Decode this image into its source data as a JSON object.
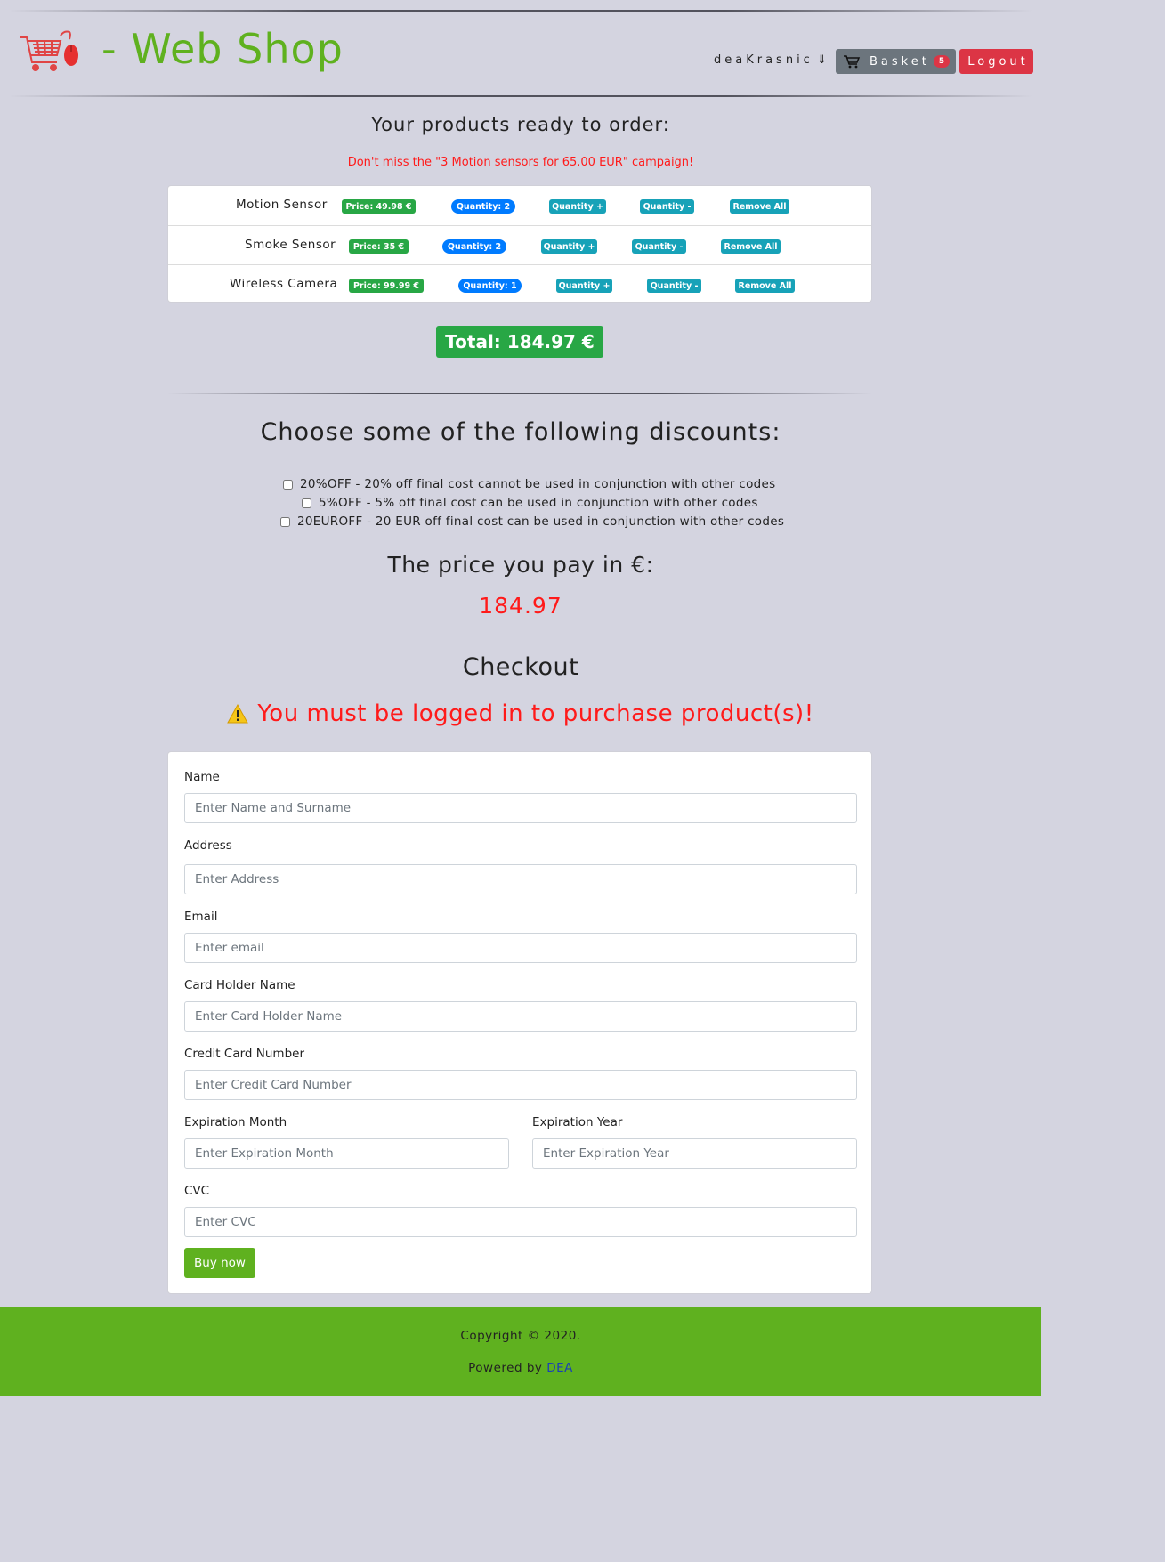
{
  "header": {
    "site_title": "- Web Shop",
    "username": "deaKrasnic",
    "basket_label": "Basket",
    "basket_count": "5",
    "logout_label": "Logout"
  },
  "basket": {
    "heading": "Your products ready to order:",
    "campaign": "Don't miss the \"3 Motion sensors for 65.00 EUR\" campaign!",
    "products": [
      {
        "name": "Motion Sensor",
        "price": "Price: 49.98 €",
        "quantity": "Quantity: 2",
        "inc": "Quantity +",
        "dec": "Quantity -",
        "remove": "Remove All"
      },
      {
        "name": "Smoke Sensor",
        "price": "Price: 35 €",
        "quantity": "Quantity: 2",
        "inc": "Quantity +",
        "dec": "Quantity -",
        "remove": "Remove All"
      },
      {
        "name": "Wireless Camera",
        "price": "Price: 99.99 €",
        "quantity": "Quantity: 1",
        "inc": "Quantity +",
        "dec": "Quantity -",
        "remove": "Remove All"
      }
    ],
    "total": "Total: 184.97 €"
  },
  "discounts": {
    "heading": "Choose some of the following discounts:",
    "options": [
      "20%OFF - 20% off final cost cannot be used in conjunction with other codes",
      "5%OFF - 5% off final cost can be used in conjunction with other codes",
      "20EUROFF - 20 EUR off final cost can be used in conjunction with other codes"
    ]
  },
  "price": {
    "heading": "The price you pay in €:",
    "value": "184.97"
  },
  "checkout": {
    "heading": "Checkout",
    "warning": "You must be logged in to purchase product(s)!",
    "fields": {
      "name": {
        "label": "Name",
        "placeholder": "Enter Name and Surname"
      },
      "address": {
        "label": "Address",
        "placeholder": "Enter Address"
      },
      "email": {
        "label": "Email",
        "placeholder": "Enter email"
      },
      "card_holder": {
        "label": "Card Holder Name",
        "placeholder": "Enter Card Holder Name"
      },
      "card_number": {
        "label": "Credit Card Number",
        "placeholder": "Enter Credit Card Number"
      },
      "exp_month": {
        "label": "Expiration Month",
        "placeholder": "Enter Expiration Month"
      },
      "exp_year": {
        "label": "Expiration Year",
        "placeholder": "Enter Expiration Year"
      },
      "cvc": {
        "label": "CVC",
        "placeholder": "Enter CVC"
      }
    },
    "buy_label": "Buy now"
  },
  "footer": {
    "copyright": "Copyright © 2020.",
    "powered_prefix": "Powered by",
    "powered_link": "DEA"
  },
  "colors": {
    "brand_green": "#5fb11f",
    "badge_green": "#28a745",
    "badge_blue": "#007bff",
    "badge_teal": "#17a2b8",
    "danger_red": "#dc3545",
    "alert_text_red": "#ff1a1a",
    "page_bg": "#d4d4e0"
  }
}
